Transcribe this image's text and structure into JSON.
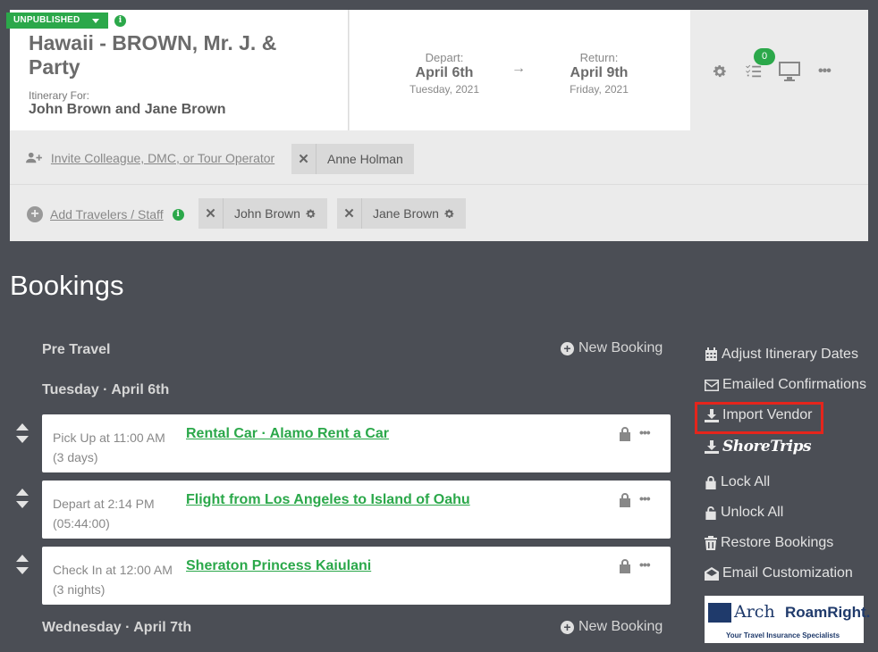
{
  "header": {
    "status_label": "UNPUBLISHED",
    "trip_title": "Hawaii - BROWN, Mr. J. & Party",
    "itinerary_for_label": "Itinerary For:",
    "itinerary_for_names": "John Brown and Jane Brown",
    "depart": {
      "label": "Depart:",
      "day": "April 6th",
      "year": "Tuesday, 2021"
    },
    "return": {
      "label": "Return:",
      "day": "April 9th",
      "year": "Friday, 2021"
    },
    "arrow": "→",
    "checklist_count": "0",
    "more": "•••"
  },
  "collaborators": {
    "invite_label": "Invite Colleague, DMC, or Tour Operator",
    "chips": [
      {
        "name": "Anne Holman"
      }
    ]
  },
  "travelers": {
    "add_label": "Add Travelers / Staff",
    "chips": [
      {
        "name": "John Brown"
      },
      {
        "name": "Jane Brown"
      }
    ]
  },
  "bookings": {
    "title": "Bookings",
    "pre_travel_label": "Pre Travel",
    "new_booking_label": "New Booking",
    "days": [
      {
        "label": "Tuesday · April 6th",
        "items": [
          {
            "meta_line1": "Pick Up at 11:00 AM",
            "meta_line2": "(3 days)",
            "name": "Rental Car · Alamo Rent a Car"
          },
          {
            "meta_line1": "Depart at 2:14 PM",
            "meta_line2": "(05:44:00)",
            "name": "Flight from Los Angeles to Island of Oahu"
          },
          {
            "meta_line1": "Check In at 12:00 AM",
            "meta_line2": "(3 nights)",
            "name": "Sheraton Princess Kaiulani"
          }
        ]
      },
      {
        "label": "Wednesday · April 7th"
      }
    ],
    "dots": "•••"
  },
  "side_menu": {
    "items": [
      {
        "label": "Adjust Itinerary Dates",
        "icon": "calendar-icon"
      },
      {
        "label": "Emailed Confirmations",
        "icon": "envelope-icon"
      },
      {
        "label": "Import Vendor",
        "icon": "download-icon"
      },
      {
        "label": "ShoreTrips",
        "icon": "download-icon"
      },
      {
        "label": "Lock All",
        "icon": "lock-icon"
      },
      {
        "label": "Unlock All",
        "icon": "unlock-icon"
      },
      {
        "label": "Restore Bookings",
        "icon": "trash-icon"
      },
      {
        "label": "Email Customization",
        "icon": "envelope-open-icon"
      }
    ]
  },
  "sponsor": {
    "arch": "Arch",
    "roamright": "RoamRight.",
    "tagline": "Your Travel Insurance Specialists"
  },
  "colors": {
    "accent_green": "#2ba84a",
    "background": "#4b4e55",
    "highlight_red": "#e5251c"
  }
}
